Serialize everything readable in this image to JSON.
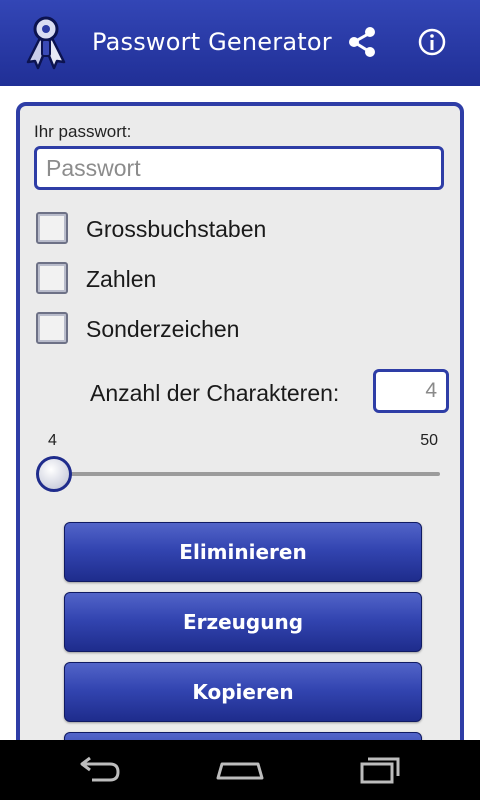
{
  "actionbar": {
    "title": "Passwort Generator",
    "logo_icon": "key-ribbon-logo-icon",
    "share_icon": "share-icon",
    "info_icon": "info-icon",
    "color": "#2b3aa3"
  },
  "form": {
    "password_label": "Ihr passwort:",
    "password_placeholder": "Passwort",
    "password_value": "",
    "options": [
      {
        "label": "Grossbuchstaben",
        "checked": false
      },
      {
        "label": "Zahlen",
        "checked": false
      },
      {
        "label": "Sonderzeichen",
        "checked": false
      }
    ],
    "count_label": "Anzahl der Charakteren:",
    "count_value": "4"
  },
  "slider": {
    "min_label": "4",
    "max_label": "50",
    "min": 4,
    "max": 50,
    "value": 4
  },
  "buttons": [
    {
      "label": "Eliminieren"
    },
    {
      "label": "Erzeugung"
    },
    {
      "label": "Kopieren"
    },
    {
      "label": ""
    }
  ],
  "navbar": {
    "back_icon": "back-icon",
    "home_icon": "home-icon",
    "recents_icon": "recent-apps-icon"
  }
}
